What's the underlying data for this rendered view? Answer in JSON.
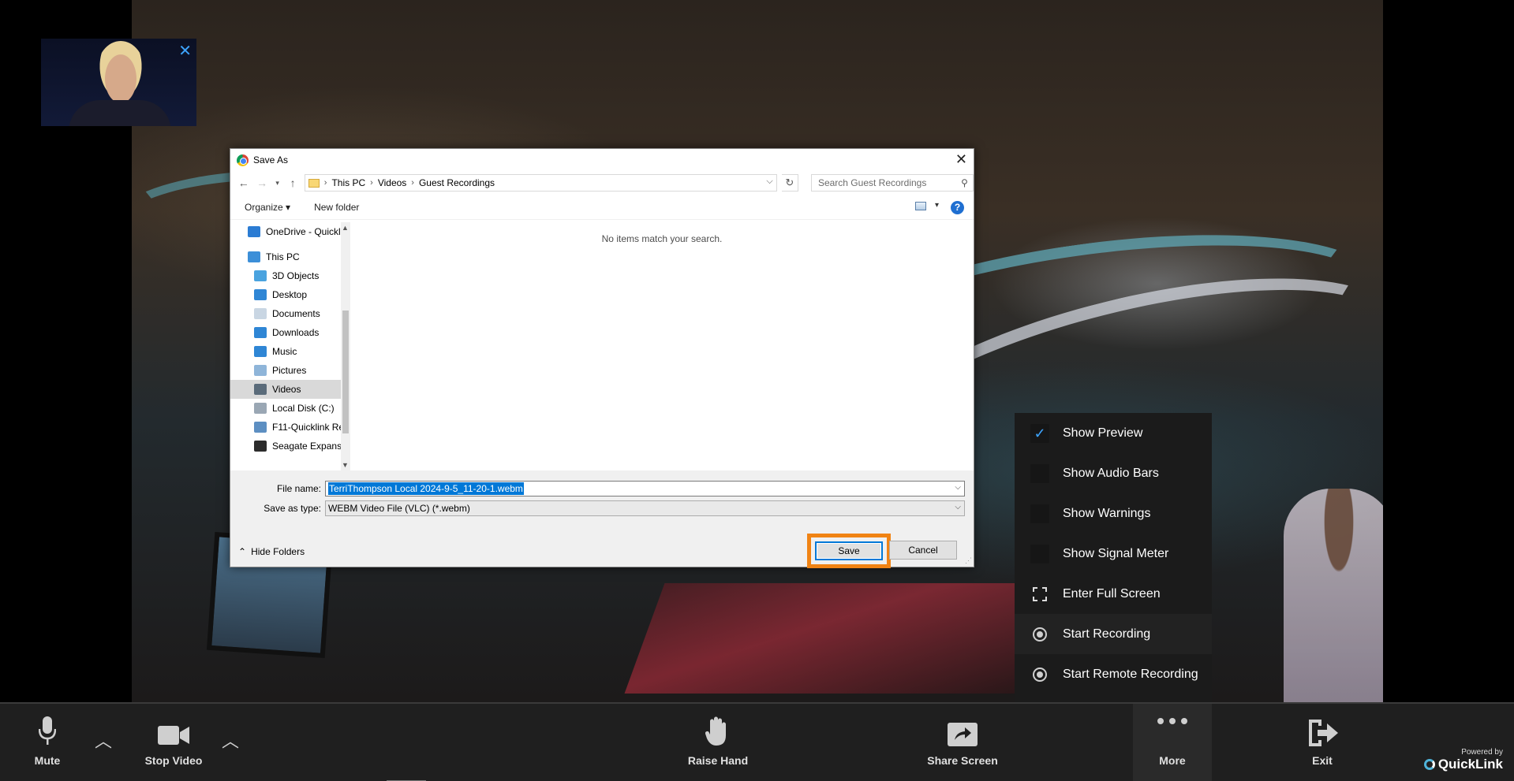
{
  "self_preview": {
    "close_label": "✕"
  },
  "dialog": {
    "title": "Save As",
    "close_label": "✕",
    "breadcrumb": [
      "This PC",
      "Videos",
      "Guest Recordings"
    ],
    "search_placeholder": "Search Guest Recordings",
    "toolbar": {
      "organize_label": "Organize ▾",
      "new_folder_label": "New folder"
    },
    "nav_items": [
      {
        "label": "OneDrive - Quickl",
        "icon": "cloud-icon",
        "color": "#2b7cd3"
      },
      {
        "label": "This PC",
        "icon": "computer-icon",
        "color": "#3c8fd8"
      },
      {
        "label": "3D Objects",
        "icon": "cube-icon",
        "color": "#4aa3df"
      },
      {
        "label": "Desktop",
        "icon": "desktop-icon",
        "color": "#2f86d5"
      },
      {
        "label": "Documents",
        "icon": "document-icon",
        "color": "#c9d6e3"
      },
      {
        "label": "Downloads",
        "icon": "download-arrow-icon",
        "color": "#2f86d5"
      },
      {
        "label": "Music",
        "icon": "music-note-icon",
        "color": "#2f86d5"
      },
      {
        "label": "Pictures",
        "icon": "picture-icon",
        "color": "#8fb5d9"
      },
      {
        "label": "Videos",
        "icon": "film-icon",
        "color": "#5a6b7a"
      },
      {
        "label": "Local Disk (C:)",
        "icon": "drive-icon",
        "color": "#9aa7b4"
      },
      {
        "label": "F11-Quicklink Re",
        "icon": "network-drive-icon",
        "color": "#5d8fc2"
      },
      {
        "label": "Seagate Expansic",
        "icon": "external-drive-icon",
        "color": "#2c2c2c"
      }
    ],
    "selected_nav": "Videos",
    "empty_message": "No items match your search.",
    "file_name_label": "File name:",
    "file_name_value": "TerriThompson Local 2024-9-5_11-20-1.webm",
    "save_type_label": "Save as type:",
    "save_type_value": "WEBM Video File (VLC) (*.webm)",
    "hide_folders_label": "Hide Folders",
    "save_label": "Save",
    "cancel_label": "Cancel"
  },
  "more_menu": {
    "items": [
      {
        "label": "Show Preview",
        "icon": "checkbox-checked-icon",
        "checked": true
      },
      {
        "label": "Show Audio Bars",
        "icon": "checkbox-icon",
        "checked": false
      },
      {
        "label": "Show Warnings",
        "icon": "checkbox-icon",
        "checked": false
      },
      {
        "label": "Show Signal Meter",
        "icon": "checkbox-icon",
        "checked": false
      },
      {
        "label": "Enter Full Screen",
        "icon": "fullscreen-icon"
      },
      {
        "label": "Start Recording",
        "icon": "record-icon"
      },
      {
        "label": "Start Remote Recording",
        "icon": "record-icon"
      }
    ]
  },
  "toolbar": {
    "mute_label": "Mute",
    "stop_video_label": "Stop Video",
    "raise_hand_label": "Raise Hand",
    "share_screen_label": "Share Screen",
    "more_label": "More",
    "exit_label": "Exit"
  },
  "branding": {
    "powered_by": "Powered by",
    "brand": "QuickLink"
  },
  "colors": {
    "accent": "#3da4ff",
    "highlight": "#f08314",
    "selection": "#0078d7"
  }
}
